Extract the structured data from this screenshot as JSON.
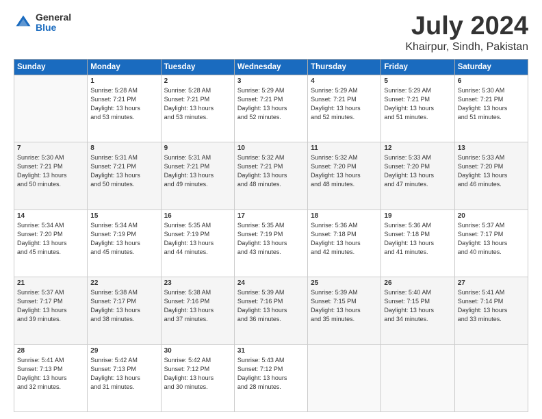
{
  "logo": {
    "general": "General",
    "blue": "Blue"
  },
  "title": "July 2024",
  "subtitle": "Khairpur, Sindh, Pakistan",
  "days": [
    "Sunday",
    "Monday",
    "Tuesday",
    "Wednesday",
    "Thursday",
    "Friday",
    "Saturday"
  ],
  "weeks": [
    [
      {
        "day": "",
        "content": ""
      },
      {
        "day": "1",
        "content": "Sunrise: 5:28 AM\nSunset: 7:21 PM\nDaylight: 13 hours\nand 53 minutes."
      },
      {
        "day": "2",
        "content": "Sunrise: 5:28 AM\nSunset: 7:21 PM\nDaylight: 13 hours\nand 53 minutes."
      },
      {
        "day": "3",
        "content": "Sunrise: 5:29 AM\nSunset: 7:21 PM\nDaylight: 13 hours\nand 52 minutes."
      },
      {
        "day": "4",
        "content": "Sunrise: 5:29 AM\nSunset: 7:21 PM\nDaylight: 13 hours\nand 52 minutes."
      },
      {
        "day": "5",
        "content": "Sunrise: 5:29 AM\nSunset: 7:21 PM\nDaylight: 13 hours\nand 51 minutes."
      },
      {
        "day": "6",
        "content": "Sunrise: 5:30 AM\nSunset: 7:21 PM\nDaylight: 13 hours\nand 51 minutes."
      }
    ],
    [
      {
        "day": "7",
        "content": "Sunrise: 5:30 AM\nSunset: 7:21 PM\nDaylight: 13 hours\nand 50 minutes."
      },
      {
        "day": "8",
        "content": "Sunrise: 5:31 AM\nSunset: 7:21 PM\nDaylight: 13 hours\nand 50 minutes."
      },
      {
        "day": "9",
        "content": "Sunrise: 5:31 AM\nSunset: 7:21 PM\nDaylight: 13 hours\nand 49 minutes."
      },
      {
        "day": "10",
        "content": "Sunrise: 5:32 AM\nSunset: 7:21 PM\nDaylight: 13 hours\nand 48 minutes."
      },
      {
        "day": "11",
        "content": "Sunrise: 5:32 AM\nSunset: 7:20 PM\nDaylight: 13 hours\nand 48 minutes."
      },
      {
        "day": "12",
        "content": "Sunrise: 5:33 AM\nSunset: 7:20 PM\nDaylight: 13 hours\nand 47 minutes."
      },
      {
        "day": "13",
        "content": "Sunrise: 5:33 AM\nSunset: 7:20 PM\nDaylight: 13 hours\nand 46 minutes."
      }
    ],
    [
      {
        "day": "14",
        "content": "Sunrise: 5:34 AM\nSunset: 7:20 PM\nDaylight: 13 hours\nand 45 minutes."
      },
      {
        "day": "15",
        "content": "Sunrise: 5:34 AM\nSunset: 7:19 PM\nDaylight: 13 hours\nand 45 minutes."
      },
      {
        "day": "16",
        "content": "Sunrise: 5:35 AM\nSunset: 7:19 PM\nDaylight: 13 hours\nand 44 minutes."
      },
      {
        "day": "17",
        "content": "Sunrise: 5:35 AM\nSunset: 7:19 PM\nDaylight: 13 hours\nand 43 minutes."
      },
      {
        "day": "18",
        "content": "Sunrise: 5:36 AM\nSunset: 7:18 PM\nDaylight: 13 hours\nand 42 minutes."
      },
      {
        "day": "19",
        "content": "Sunrise: 5:36 AM\nSunset: 7:18 PM\nDaylight: 13 hours\nand 41 minutes."
      },
      {
        "day": "20",
        "content": "Sunrise: 5:37 AM\nSunset: 7:17 PM\nDaylight: 13 hours\nand 40 minutes."
      }
    ],
    [
      {
        "day": "21",
        "content": "Sunrise: 5:37 AM\nSunset: 7:17 PM\nDaylight: 13 hours\nand 39 minutes."
      },
      {
        "day": "22",
        "content": "Sunrise: 5:38 AM\nSunset: 7:17 PM\nDaylight: 13 hours\nand 38 minutes."
      },
      {
        "day": "23",
        "content": "Sunrise: 5:38 AM\nSunset: 7:16 PM\nDaylight: 13 hours\nand 37 minutes."
      },
      {
        "day": "24",
        "content": "Sunrise: 5:39 AM\nSunset: 7:16 PM\nDaylight: 13 hours\nand 36 minutes."
      },
      {
        "day": "25",
        "content": "Sunrise: 5:39 AM\nSunset: 7:15 PM\nDaylight: 13 hours\nand 35 minutes."
      },
      {
        "day": "26",
        "content": "Sunrise: 5:40 AM\nSunset: 7:15 PM\nDaylight: 13 hours\nand 34 minutes."
      },
      {
        "day": "27",
        "content": "Sunrise: 5:41 AM\nSunset: 7:14 PM\nDaylight: 13 hours\nand 33 minutes."
      }
    ],
    [
      {
        "day": "28",
        "content": "Sunrise: 5:41 AM\nSunset: 7:13 PM\nDaylight: 13 hours\nand 32 minutes."
      },
      {
        "day": "29",
        "content": "Sunrise: 5:42 AM\nSunset: 7:13 PM\nDaylight: 13 hours\nand 31 minutes."
      },
      {
        "day": "30",
        "content": "Sunrise: 5:42 AM\nSunset: 7:12 PM\nDaylight: 13 hours\nand 30 minutes."
      },
      {
        "day": "31",
        "content": "Sunrise: 5:43 AM\nSunset: 7:12 PM\nDaylight: 13 hours\nand 28 minutes."
      },
      {
        "day": "",
        "content": ""
      },
      {
        "day": "",
        "content": ""
      },
      {
        "day": "",
        "content": ""
      }
    ]
  ]
}
